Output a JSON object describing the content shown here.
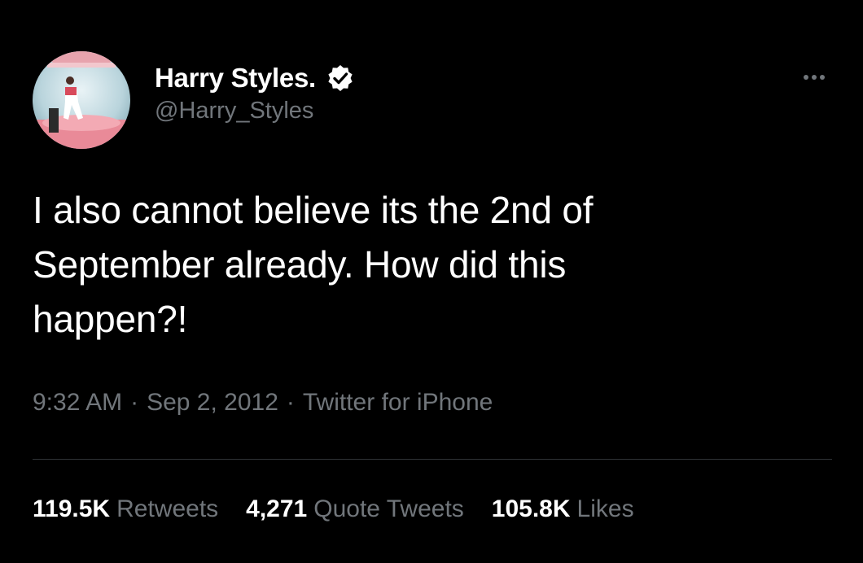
{
  "author": {
    "display_name": "Harry Styles.",
    "handle": "@Harry_Styles",
    "verified_icon": "verified-badge-icon",
    "avatar_icon": "profile-avatar"
  },
  "menu": {
    "more_icon": "more-options-icon"
  },
  "tweet": {
    "text": "I also cannot believe its the 2nd of\nSeptember already. How did this\nhappen?!",
    "time": "9:32 AM",
    "date": "Sep 2, 2012",
    "source": "Twitter for iPhone",
    "separator": "·"
  },
  "stats": {
    "retweets_count": "119.5K",
    "retweets_label": "Retweets",
    "quotes_count": "4,271",
    "quotes_label": "Quote Tweets",
    "likes_count": "105.8K",
    "likes_label": "Likes"
  },
  "colors": {
    "background": "#000000",
    "text_primary": "#ffffff",
    "text_secondary": "#71767b",
    "divider": "#2f3336"
  }
}
